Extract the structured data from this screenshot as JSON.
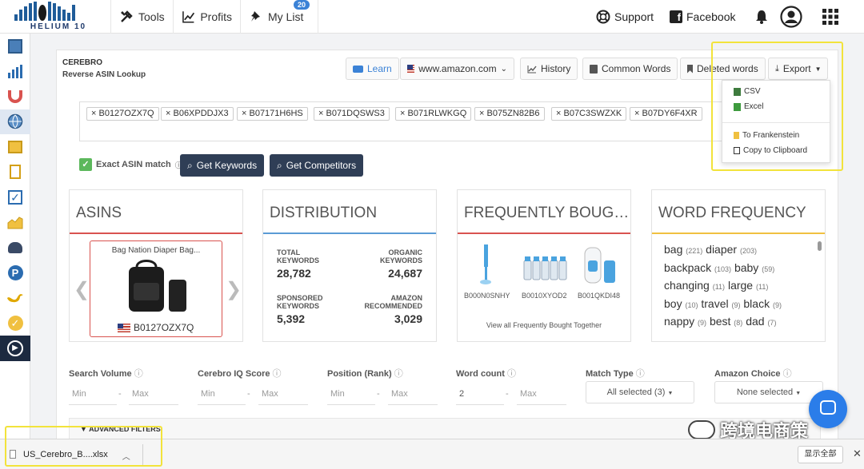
{
  "nav": {
    "tools": "Tools",
    "profits": "Profits",
    "mylist": "My List",
    "mylist_badge": "20",
    "support": "Support",
    "facebook": "Facebook",
    "logo_text": "HELIUM 10"
  },
  "page": {
    "title": "CEREBRO",
    "subtitle": "Reverse ASIN Lookup"
  },
  "toolbar": {
    "learn": "Learn",
    "marketplace": "www.amazon.com",
    "history": "History",
    "common_words": "Common Words",
    "deleted_words": "Deleted words",
    "export": "Export"
  },
  "export_menu": {
    "csv": "CSV",
    "excel": "Excel",
    "frankenstein": "To Frankenstein",
    "clipboard": "Copy to Clipboard"
  },
  "asins": [
    "B0127OZX7Q",
    "B06XPDDJX3",
    "B07171H6HS",
    "B071DQSWS3",
    "B071RLWKGQ",
    "B075ZN82B6",
    "B07C3SWZXK",
    "B07DY6F4XR"
  ],
  "options": {
    "exact_match": "Exact ASIN match",
    "get_keywords": "Get Keywords",
    "get_competitors": "Get Competitors"
  },
  "cards": {
    "asins": {
      "title": "ASINS",
      "product_name": "Bag Nation Diaper Bag...",
      "asin": "B0127OZX7Q"
    },
    "distribution": {
      "title": "DISTRIBUTION",
      "total_label_1": "TOTAL",
      "total_label_2": "KEYWORDS",
      "total_value": "28,782",
      "organic_label_1": "ORGANIC",
      "organic_label_2": "KEYWORDS",
      "organic_value": "24,687",
      "sponsored_label_1": "SPONSORED",
      "sponsored_label_2": "KEYWORDS",
      "sponsored_value": "5,392",
      "recommended_label_1": "AMAZON",
      "recommended_label_2": "RECOMMENDED",
      "recommended_value": "3,029"
    },
    "fbt": {
      "title": "FREQUENTLY BOUG…",
      "items": [
        "B000N0SNHY",
        "B0010XYOD2",
        "B001QKDI48"
      ],
      "view_all": "View all Frequently Bought Together"
    },
    "word_frequency": {
      "title": "WORD FREQUENCY",
      "rows": [
        [
          {
            "w": "bag",
            "n": "(221)"
          },
          {
            "w": "diaper",
            "n": "(203)"
          }
        ],
        [
          {
            "w": "backpack",
            "n": "(103)"
          },
          {
            "w": "baby",
            "n": "(59)"
          }
        ],
        [
          {
            "w": "changing",
            "n": "(11)"
          },
          {
            "w": "large",
            "n": "(11)"
          }
        ],
        [
          {
            "w": "boy",
            "n": "(10)"
          },
          {
            "w": "travel",
            "n": "(9)"
          },
          {
            "w": "black",
            "n": "(9)"
          }
        ],
        [
          {
            "w": "nappy",
            "n": "(9)"
          },
          {
            "w": "best",
            "n": "(8)"
          },
          {
            "w": "dad",
            "n": "(7)"
          }
        ]
      ]
    }
  },
  "filters": {
    "search_volume": "Search Volume",
    "cerebro_iq": "Cerebro IQ Score",
    "position": "Position (Rank)",
    "word_count": "Word count",
    "match_type": "Match Type",
    "amazon_choice": "Amazon Choice",
    "min": "Min",
    "max": "Max",
    "word_count_min": "2",
    "match_type_value": "All selected (3)",
    "amazon_choice_value": "None selected",
    "advanced": "ADVANCED FILTERS"
  },
  "download": {
    "file": "US_Cerebro_B....xlsx",
    "show_all": "显示全部"
  },
  "watermark": "跨境电商策",
  "colors": {
    "accent_red": "#d9534f",
    "accent_blue": "#5b9bd5",
    "dark_button": "#2f3e56",
    "highlight": "#f2e33b"
  }
}
